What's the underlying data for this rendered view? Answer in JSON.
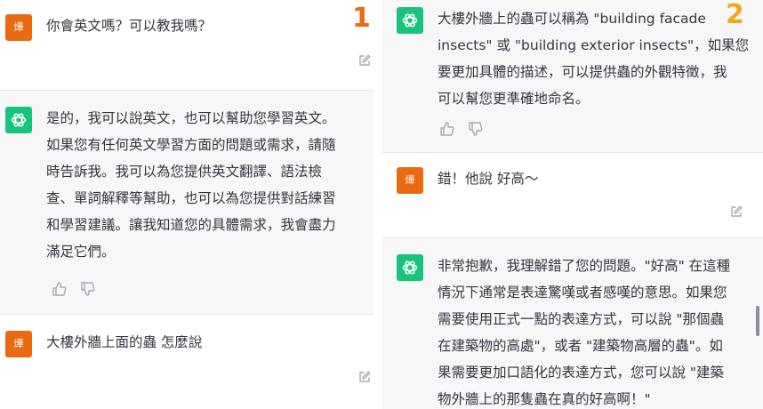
{
  "left_panel": {
    "messages": [
      {
        "role": "user",
        "avatar_text": "燁",
        "text": "你會英文嗎？可以教我嗎？"
      },
      {
        "role": "assistant",
        "text": "是的，我可以說英文，也可以幫助您學習英文。\n如果您有任何英文學習方面的問題或需求，請隨\n時告訴我。我可以為您提供英文翻譯、語法檢\n查、單詞解釋等幫助，也可以為您提供對話練習\n和學習建議。讓我知道您的具體需求，我會盡力\n滿足它們。"
      },
      {
        "role": "user",
        "avatar_text": "燁",
        "text": "大樓外牆上面的蟲 怎麼說"
      }
    ],
    "annotation": "1"
  },
  "right_panel": {
    "messages": [
      {
        "role": "assistant",
        "text": "大樓外牆上的蟲可以稱為 \"building facade\ninsects\" 或 \"building exterior insects\"，如果您\n要更加具體的描述，可以提供蟲的外觀特徵，我\n可以幫您更準確地命名。"
      },
      {
        "role": "user",
        "avatar_text": "燁",
        "text": "錯！他說 好高～"
      },
      {
        "role": "assistant",
        "text": "非常抱歉，我理解錯了您的問題。\"好高\" 在這種\n情況下通常是表達驚嘆或者感嘆的意思。如果您\n需要使用正式一點的表達方式，可以說 \"那個蟲\n在建築物的高處\"，或者 \"建築物高層的蟲\"。如\n果需要更加口語化的表達方式，您可以說 \"建築\n物外牆上的那隻蟲在真的好高啊！\""
      }
    ],
    "annotation": "2"
  },
  "icons": {
    "assistant_avatar": "openai-logo-icon",
    "edit": "edit-icon",
    "like": "thumbs-up-icon",
    "dislike": "thumbs-down-icon"
  },
  "colors": {
    "user_avatar": "#ea6a12",
    "assistant_avatar": "#19c37d",
    "assistant_bg": "#f7f7f8",
    "annotation_1": "#ea6a12",
    "annotation_2": "#f0a820"
  }
}
